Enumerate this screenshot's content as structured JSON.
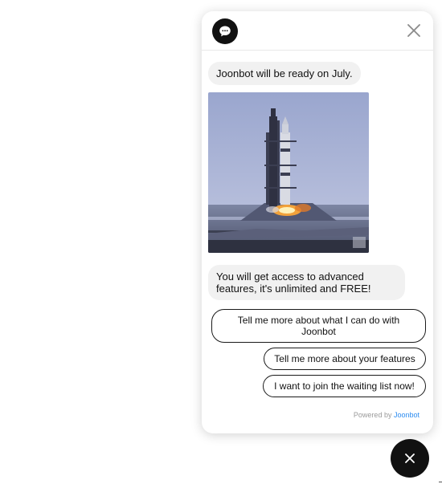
{
  "chat": {
    "messages": [
      {
        "text": "Joonbot will be ready on July."
      },
      {
        "text": "You will get access to advanced features, it's unlimited and FREE!"
      }
    ],
    "media": {
      "icon": "rocket-launch-gif"
    },
    "options": [
      {
        "label": "Tell me more about what I can do with Joonbot"
      },
      {
        "label": "Tell me more about your features"
      },
      {
        "label": "I want to join the waiting list now!"
      }
    ],
    "footer": {
      "powered_prefix": "Powered by",
      "brand": "Joonbot"
    }
  },
  "icons": {
    "avatar": "chat-bubble-icon",
    "close": "close-icon",
    "launcher": "close-icon"
  },
  "colors": {
    "accent": "#111111",
    "bubble": "#f1f1f1",
    "brand_link": "#2d8cf0"
  }
}
